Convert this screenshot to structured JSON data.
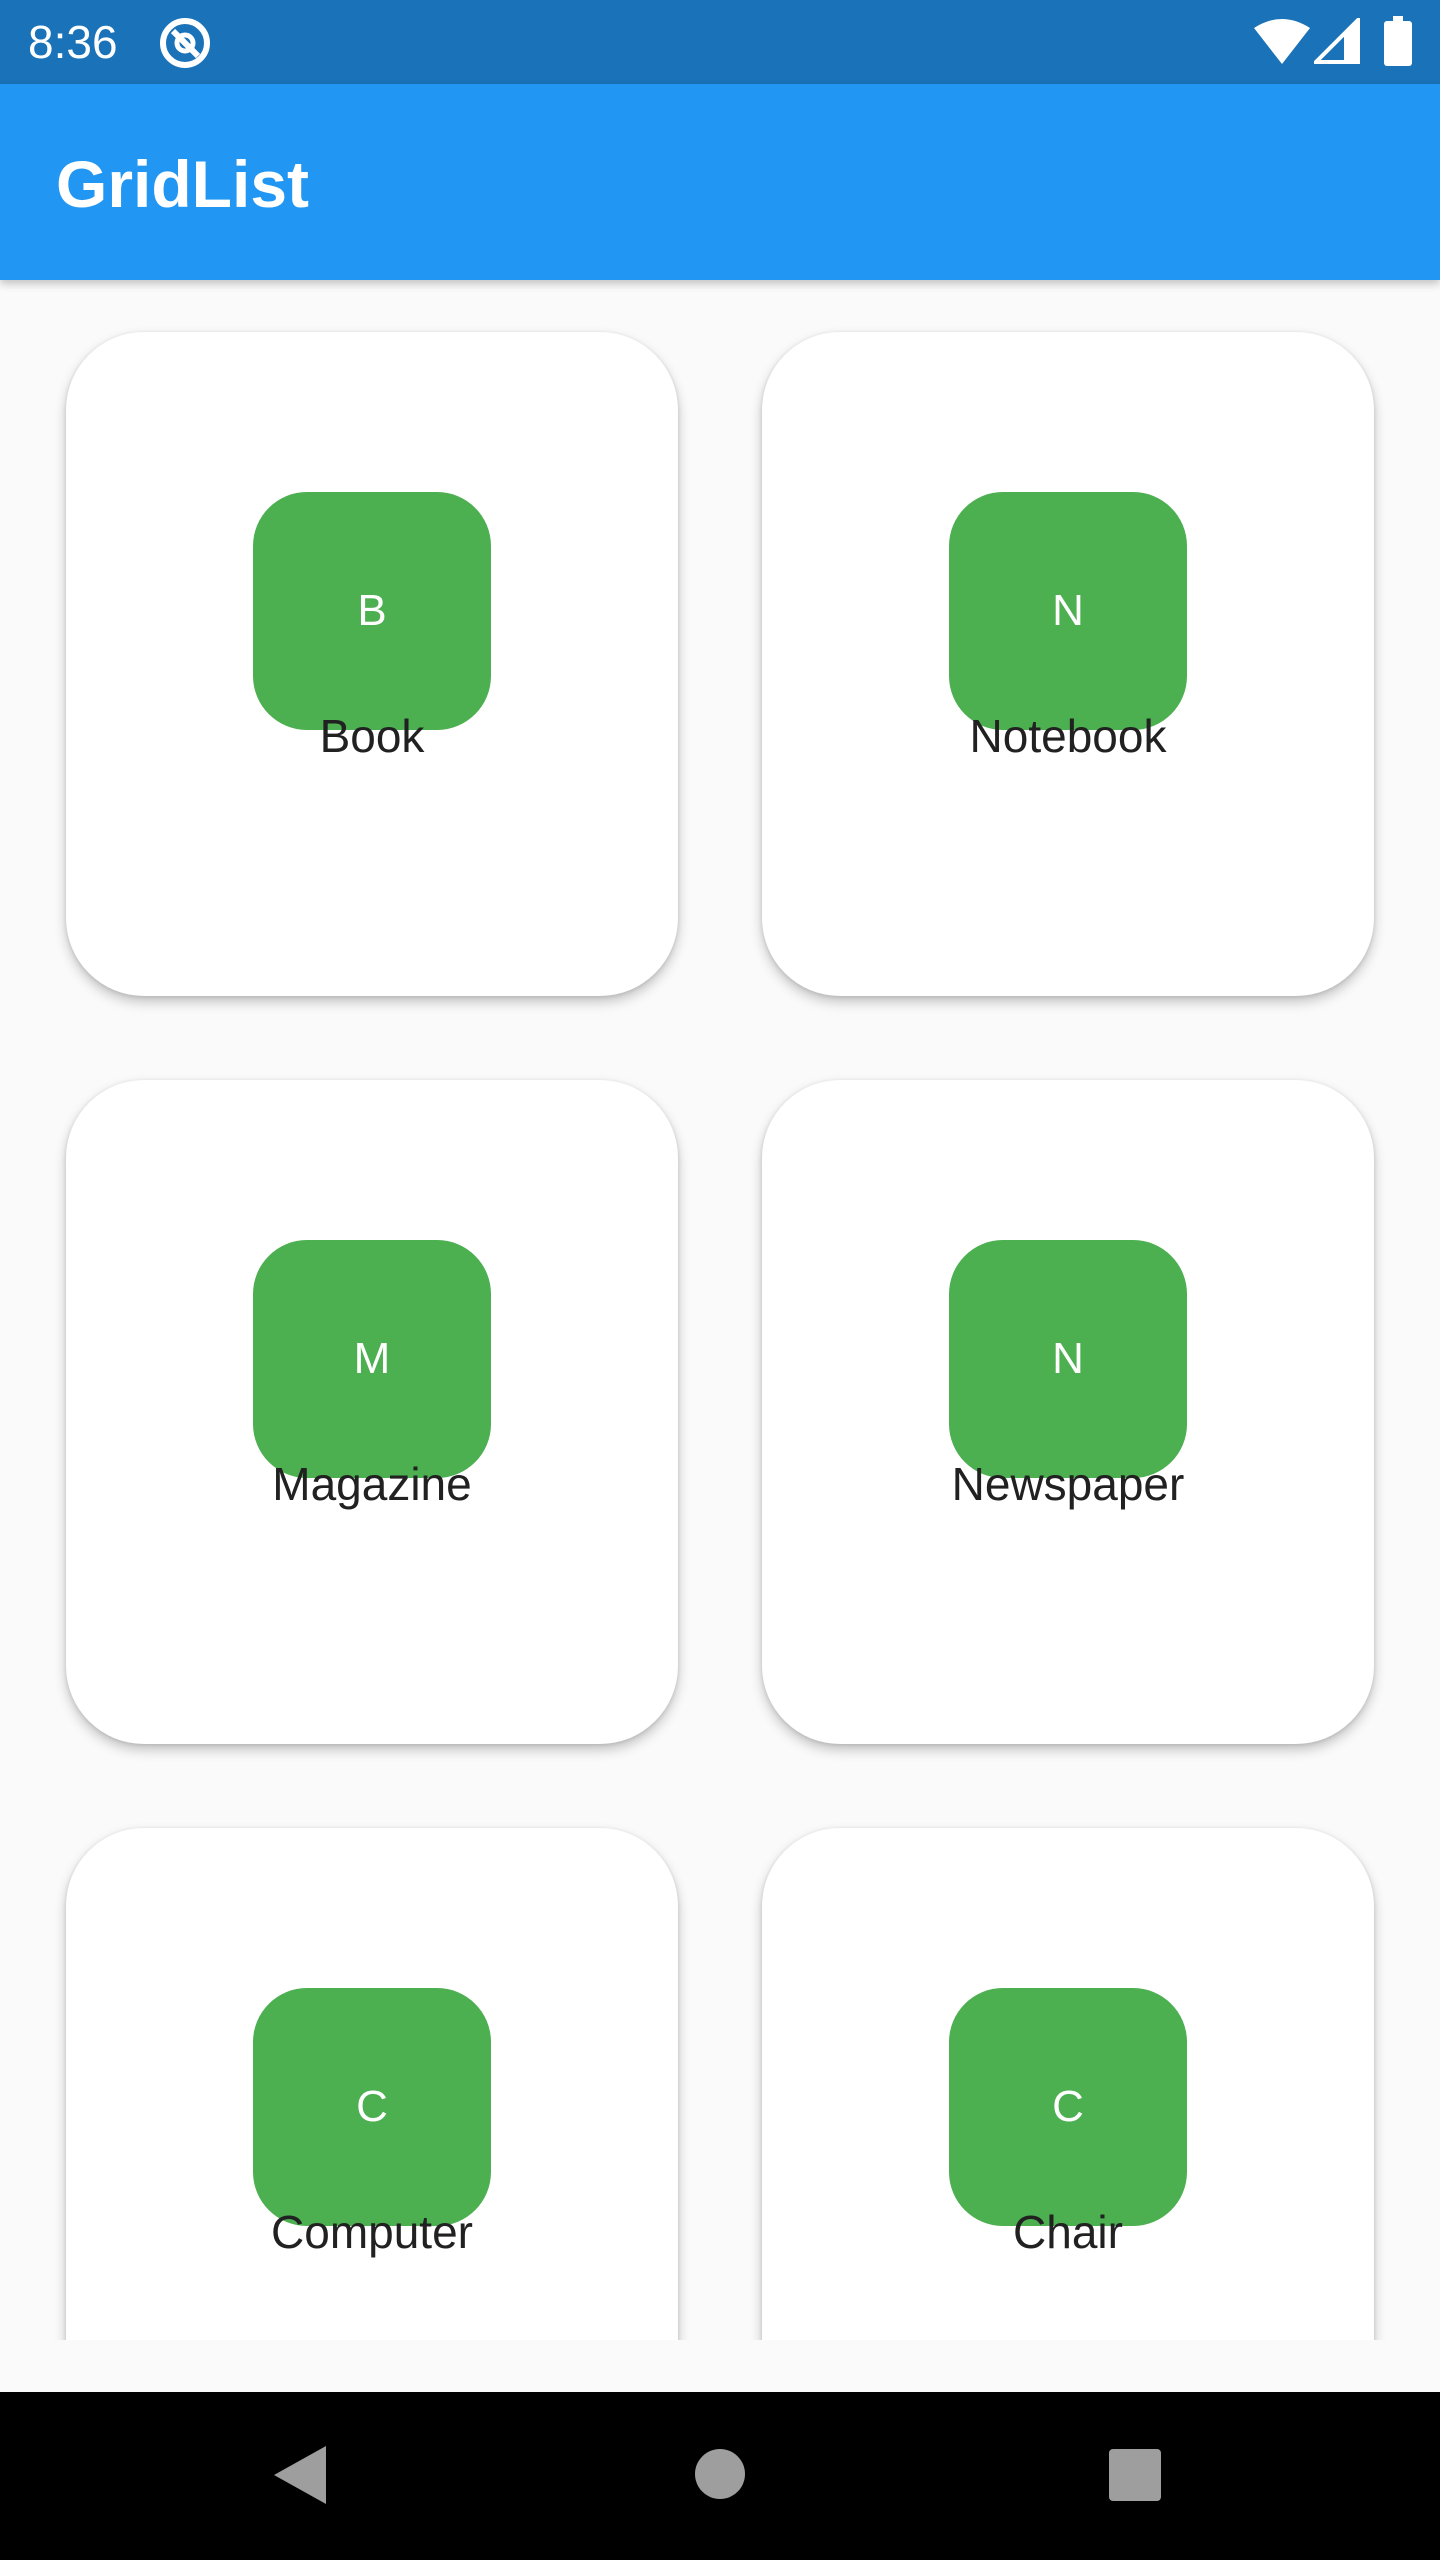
{
  "status_bar": {
    "time": "8:36",
    "app_icon": "at-sign-icon",
    "wifi_icon": "wifi-icon",
    "signal_icon": "signal-icon",
    "battery_icon": "battery-icon"
  },
  "app_bar": {
    "title": "GridList",
    "color": "#2196f3"
  },
  "grid": {
    "avatar_color": "#4caf50",
    "items": [
      {
        "initial": "B",
        "label": "Book"
      },
      {
        "initial": "N",
        "label": "Notebook"
      },
      {
        "initial": "M",
        "label": "Magazine"
      },
      {
        "initial": "N",
        "label": "Newspaper"
      },
      {
        "initial": "C",
        "label": "Computer"
      },
      {
        "initial": "C",
        "label": "Chair"
      }
    ]
  },
  "nav_bar": {
    "back_icon": "back-triangle-icon",
    "home_icon": "home-circle-icon",
    "recents_icon": "recents-square-icon"
  }
}
